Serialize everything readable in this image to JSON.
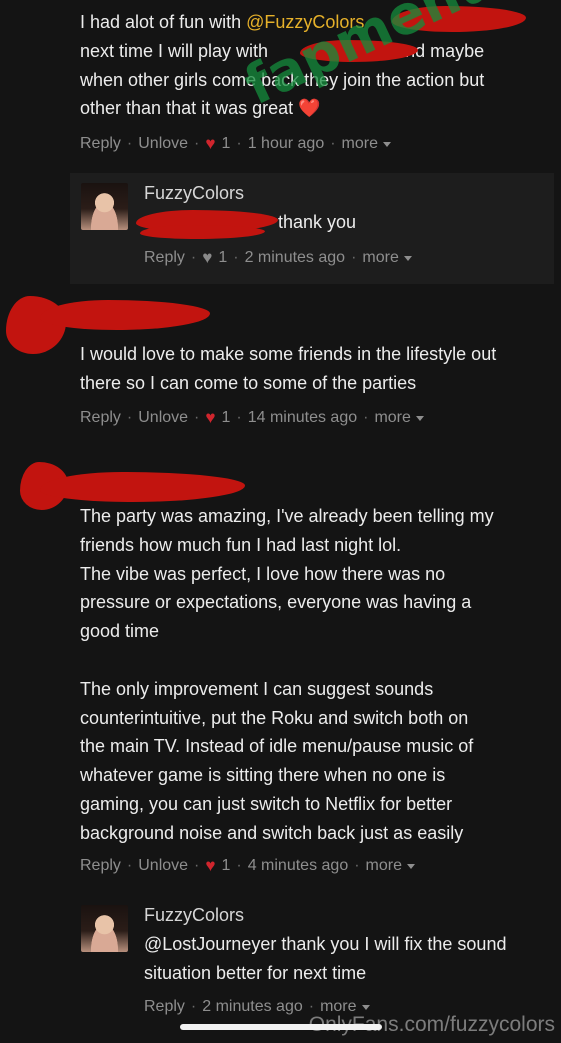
{
  "comments": [
    {
      "lines": [
        [
          "I had alot of fun with ",
          "@FuzzyColors",
          ""
        ],
        [
          "next time I will play with",
          "",
          " and maybe"
        ],
        [
          "when other girls come back they join the action but",
          "",
          ""
        ],
        [
          "other than that it was great ",
          "",
          ""
        ]
      ],
      "emoji": "❤️",
      "meta": {
        "reply": "Reply",
        "react": "Unlove",
        "count": "1",
        "time": "1 hour ago",
        "more": "more"
      }
    },
    {
      "lines": [
        "I would love to make some friends in the lifestyle out",
        "there so I can come to some of the parties"
      ],
      "meta": {
        "reply": "Reply",
        "react": "Unlove",
        "count": "1",
        "time": "14 minutes ago",
        "more": "more"
      }
    },
    {
      "lines": [
        "The party was amazing, I've already been telling my",
        "friends how much fun I had last night lol.",
        "The vibe was perfect, I love how there was no",
        "pressure or expectations, everyone was having a",
        "good time",
        "",
        "The only improvement I can suggest sounds",
        "counterintuitive, put the Roku and switch both on",
        "the main TV. Instead of idle menu/pause music of",
        "whatever game is sitting there when no one is",
        "gaming, you can just switch to Netflix for better",
        "background noise and switch back just as easily"
      ],
      "meta": {
        "reply": "Reply",
        "react": "Unlove",
        "count": "1",
        "time": "4 minutes ago",
        "more": "more"
      }
    }
  ],
  "replies": [
    {
      "name": "FuzzyColors",
      "text": "thank you",
      "meta": {
        "reply": "Reply",
        "count": "1",
        "time": "2 minutes ago",
        "more": "more"
      }
    },
    {
      "name": "FuzzyColors",
      "lines": [
        "@LostJourneyer thank you I will fix the sound",
        "situation better for next time"
      ],
      "meta": {
        "reply": "Reply",
        "time": "2 minutes ago",
        "more": "more"
      }
    }
  ],
  "watermarks": {
    "diagonal": "fapmenu.com",
    "bottom": "OnlyFans.com/fuzzycolors"
  },
  "colors": {
    "background": "#141414",
    "mention": "#e6b12a",
    "heart": "#d0252d",
    "redaction": "#c2140f",
    "meta": "#8e8e8e"
  }
}
